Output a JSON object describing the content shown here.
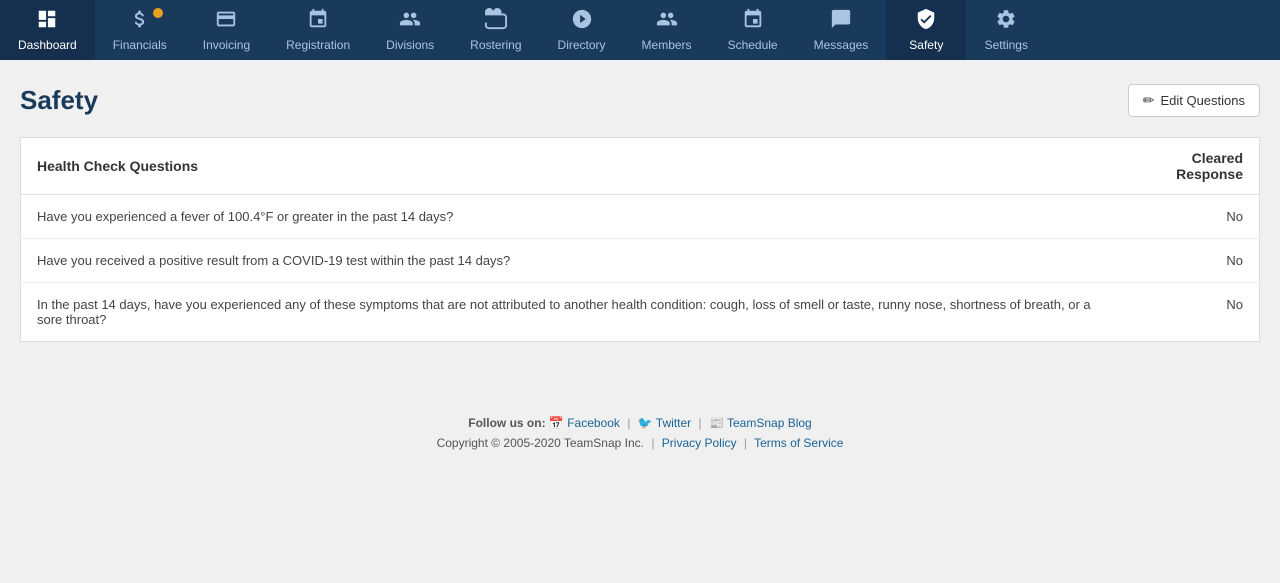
{
  "nav": {
    "items": [
      {
        "id": "dashboard",
        "label": "Dashboard",
        "icon": "dashboard"
      },
      {
        "id": "financials",
        "label": "Financials",
        "icon": "financials",
        "badge": true
      },
      {
        "id": "invoicing",
        "label": "Invoicing",
        "icon": "invoicing"
      },
      {
        "id": "registration",
        "label": "Registration",
        "icon": "registration"
      },
      {
        "id": "divisions",
        "label": "Divisions",
        "icon": "divisions"
      },
      {
        "id": "rostering",
        "label": "Rostering",
        "icon": "rostering"
      },
      {
        "id": "directory",
        "label": "Directory",
        "icon": "directory"
      },
      {
        "id": "members",
        "label": "Members",
        "icon": "members"
      },
      {
        "id": "schedule",
        "label": "Schedule",
        "icon": "schedule"
      },
      {
        "id": "messages",
        "label": "Messages",
        "icon": "messages"
      },
      {
        "id": "safety",
        "label": "Safety",
        "icon": "safety",
        "active": true
      },
      {
        "id": "settings",
        "label": "Settings",
        "icon": "settings"
      }
    ]
  },
  "page": {
    "title": "Safety",
    "edit_button_label": "Edit Questions"
  },
  "table": {
    "header_question": "Health Check Questions",
    "header_response": "Cleared Response",
    "rows": [
      {
        "question": "Have you experienced a fever of 100.4°F or greater in the past 14 days?",
        "response": "No"
      },
      {
        "question": "Have you received a positive result from a COVID-19 test within the past 14 days?",
        "response": "No"
      },
      {
        "question": "In the past 14 days, have you experienced any of these symptoms that are not attributed to another health condition: cough, loss of smell or taste, runny nose, shortness of breath, or a sore throat?",
        "response": "No"
      }
    ]
  },
  "footer": {
    "follow_label": "Follow us on:",
    "facebook_label": "Facebook",
    "twitter_label": "Twitter",
    "blog_label": "TeamSnap Blog",
    "copyright": "Copyright © 2005-2020 TeamSnap Inc.",
    "privacy_label": "Privacy Policy",
    "terms_label": "Terms of Service"
  }
}
